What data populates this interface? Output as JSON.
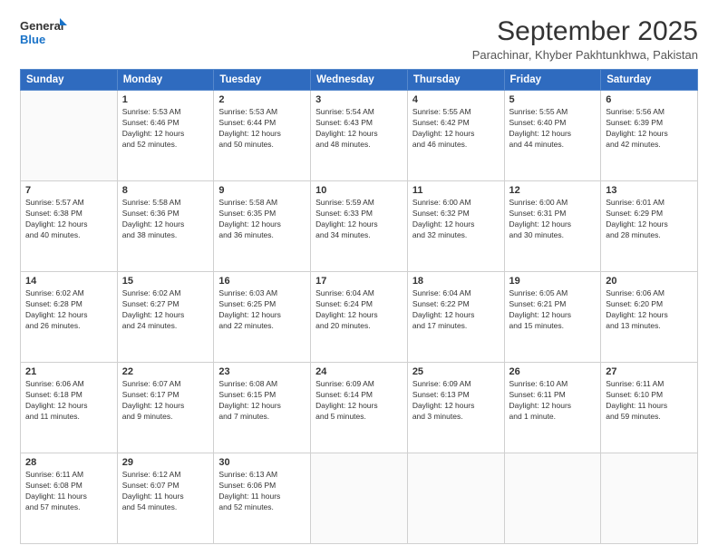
{
  "logo": {
    "line1": "General",
    "line2": "Blue"
  },
  "title": "September 2025",
  "subtitle": "Parachinar, Khyber Pakhtunkhwa, Pakistan",
  "days_of_week": [
    "Sunday",
    "Monday",
    "Tuesday",
    "Wednesday",
    "Thursday",
    "Friday",
    "Saturday"
  ],
  "weeks": [
    [
      {
        "day": "",
        "info": ""
      },
      {
        "day": "1",
        "info": "Sunrise: 5:53 AM\nSunset: 6:46 PM\nDaylight: 12 hours\nand 52 minutes."
      },
      {
        "day": "2",
        "info": "Sunrise: 5:53 AM\nSunset: 6:44 PM\nDaylight: 12 hours\nand 50 minutes."
      },
      {
        "day": "3",
        "info": "Sunrise: 5:54 AM\nSunset: 6:43 PM\nDaylight: 12 hours\nand 48 minutes."
      },
      {
        "day": "4",
        "info": "Sunrise: 5:55 AM\nSunset: 6:42 PM\nDaylight: 12 hours\nand 46 minutes."
      },
      {
        "day": "5",
        "info": "Sunrise: 5:55 AM\nSunset: 6:40 PM\nDaylight: 12 hours\nand 44 minutes."
      },
      {
        "day": "6",
        "info": "Sunrise: 5:56 AM\nSunset: 6:39 PM\nDaylight: 12 hours\nand 42 minutes."
      }
    ],
    [
      {
        "day": "7",
        "info": "Sunrise: 5:57 AM\nSunset: 6:38 PM\nDaylight: 12 hours\nand 40 minutes."
      },
      {
        "day": "8",
        "info": "Sunrise: 5:58 AM\nSunset: 6:36 PM\nDaylight: 12 hours\nand 38 minutes."
      },
      {
        "day": "9",
        "info": "Sunrise: 5:58 AM\nSunset: 6:35 PM\nDaylight: 12 hours\nand 36 minutes."
      },
      {
        "day": "10",
        "info": "Sunrise: 5:59 AM\nSunset: 6:33 PM\nDaylight: 12 hours\nand 34 minutes."
      },
      {
        "day": "11",
        "info": "Sunrise: 6:00 AM\nSunset: 6:32 PM\nDaylight: 12 hours\nand 32 minutes."
      },
      {
        "day": "12",
        "info": "Sunrise: 6:00 AM\nSunset: 6:31 PM\nDaylight: 12 hours\nand 30 minutes."
      },
      {
        "day": "13",
        "info": "Sunrise: 6:01 AM\nSunset: 6:29 PM\nDaylight: 12 hours\nand 28 minutes."
      }
    ],
    [
      {
        "day": "14",
        "info": "Sunrise: 6:02 AM\nSunset: 6:28 PM\nDaylight: 12 hours\nand 26 minutes."
      },
      {
        "day": "15",
        "info": "Sunrise: 6:02 AM\nSunset: 6:27 PM\nDaylight: 12 hours\nand 24 minutes."
      },
      {
        "day": "16",
        "info": "Sunrise: 6:03 AM\nSunset: 6:25 PM\nDaylight: 12 hours\nand 22 minutes."
      },
      {
        "day": "17",
        "info": "Sunrise: 6:04 AM\nSunset: 6:24 PM\nDaylight: 12 hours\nand 20 minutes."
      },
      {
        "day": "18",
        "info": "Sunrise: 6:04 AM\nSunset: 6:22 PM\nDaylight: 12 hours\nand 17 minutes."
      },
      {
        "day": "19",
        "info": "Sunrise: 6:05 AM\nSunset: 6:21 PM\nDaylight: 12 hours\nand 15 minutes."
      },
      {
        "day": "20",
        "info": "Sunrise: 6:06 AM\nSunset: 6:20 PM\nDaylight: 12 hours\nand 13 minutes."
      }
    ],
    [
      {
        "day": "21",
        "info": "Sunrise: 6:06 AM\nSunset: 6:18 PM\nDaylight: 12 hours\nand 11 minutes."
      },
      {
        "day": "22",
        "info": "Sunrise: 6:07 AM\nSunset: 6:17 PM\nDaylight: 12 hours\nand 9 minutes."
      },
      {
        "day": "23",
        "info": "Sunrise: 6:08 AM\nSunset: 6:15 PM\nDaylight: 12 hours\nand 7 minutes."
      },
      {
        "day": "24",
        "info": "Sunrise: 6:09 AM\nSunset: 6:14 PM\nDaylight: 12 hours\nand 5 minutes."
      },
      {
        "day": "25",
        "info": "Sunrise: 6:09 AM\nSunset: 6:13 PM\nDaylight: 12 hours\nand 3 minutes."
      },
      {
        "day": "26",
        "info": "Sunrise: 6:10 AM\nSunset: 6:11 PM\nDaylight: 12 hours\nand 1 minute."
      },
      {
        "day": "27",
        "info": "Sunrise: 6:11 AM\nSunset: 6:10 PM\nDaylight: 11 hours\nand 59 minutes."
      }
    ],
    [
      {
        "day": "28",
        "info": "Sunrise: 6:11 AM\nSunset: 6:08 PM\nDaylight: 11 hours\nand 57 minutes."
      },
      {
        "day": "29",
        "info": "Sunrise: 6:12 AM\nSunset: 6:07 PM\nDaylight: 11 hours\nand 54 minutes."
      },
      {
        "day": "30",
        "info": "Sunrise: 6:13 AM\nSunset: 6:06 PM\nDaylight: 11 hours\nand 52 minutes."
      },
      {
        "day": "",
        "info": ""
      },
      {
        "day": "",
        "info": ""
      },
      {
        "day": "",
        "info": ""
      },
      {
        "day": "",
        "info": ""
      }
    ]
  ]
}
